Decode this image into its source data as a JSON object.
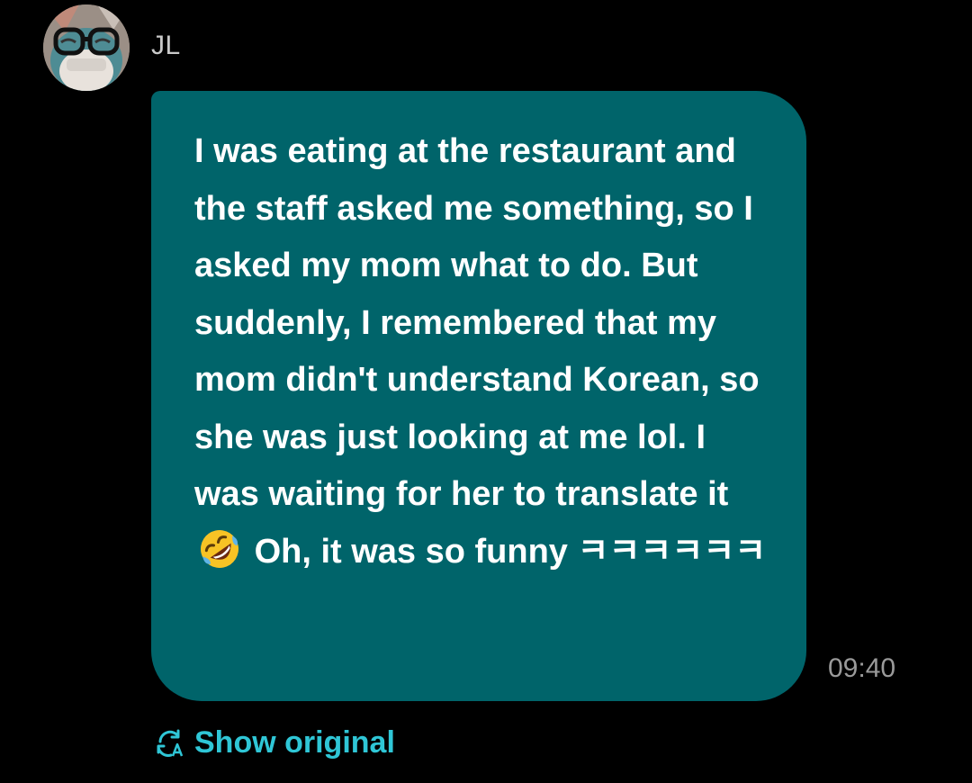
{
  "colors": {
    "background": "#000000",
    "bubble": "#00646a",
    "accent": "#2fc6d6",
    "timestamp": "#9a9a9a"
  },
  "sender": {
    "name": "JL",
    "avatar_icon": "avatar-icon"
  },
  "message": {
    "text_before_emoji": "I was eating at the restaurant and the staff asked me something, so I asked my mom what to do. But suddenly, I remembered that my mom didn't understand Korean, so she was just looking at me lol. I was waiting for her to translate it",
    "emoji": "rolling-on-floor-laughing-emoji",
    "text_after_emoji": "Oh, it was so funny ㅋㅋㅋㅋㅋㅋ",
    "time": "09:40"
  },
  "actions": {
    "show_original_label": "Show original",
    "show_original_icon": "translate-refresh-icon"
  }
}
